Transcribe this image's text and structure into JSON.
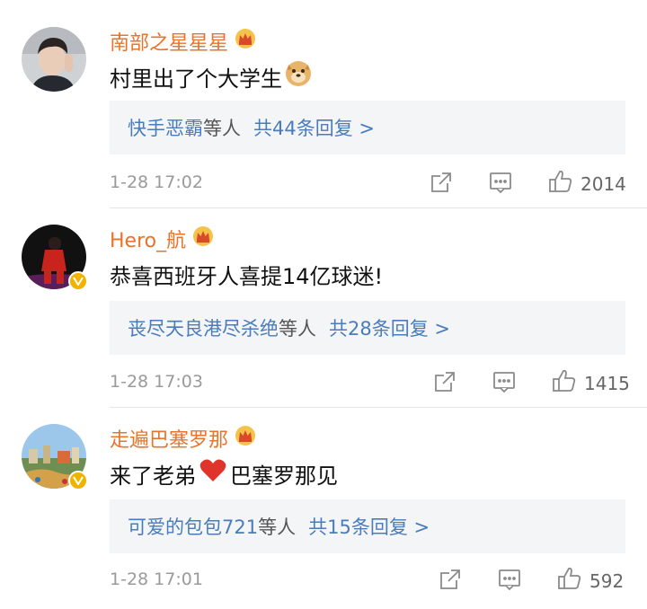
{
  "comments": [
    {
      "username": "南部之星星星",
      "text": "村里出了个大学生",
      "emoji": "doge-emoji",
      "reply_users": "快手恶霸",
      "reply_mid": "等人",
      "reply_count": "共44条回复 >",
      "time": "1-28 17:02",
      "likes": "2014"
    },
    {
      "username": "Hero_航",
      "text": "恭喜西班牙人喜提14亿球迷!",
      "reply_users": "丧尽天良港尽杀绝",
      "reply_mid": "等人",
      "reply_count": "共28条回复 >",
      "time": "1-28 17:03",
      "likes": "1415"
    },
    {
      "username": "走遍巴塞罗那",
      "text_before": "来了老弟",
      "emoji": "red-heart-emoji",
      "text_after": "巴塞罗那见",
      "reply_users": "可爱的包包721",
      "reply_mid": "等人",
      "reply_count": "共15条回复 >",
      "time": "1-28 17:01",
      "likes": "592"
    }
  ],
  "colors": {
    "username": "#e8742a",
    "link": "#4a7cbd",
    "reply_bg": "#f4f5f7",
    "meta": "#9a9a9a",
    "verified": "#f0b300"
  }
}
